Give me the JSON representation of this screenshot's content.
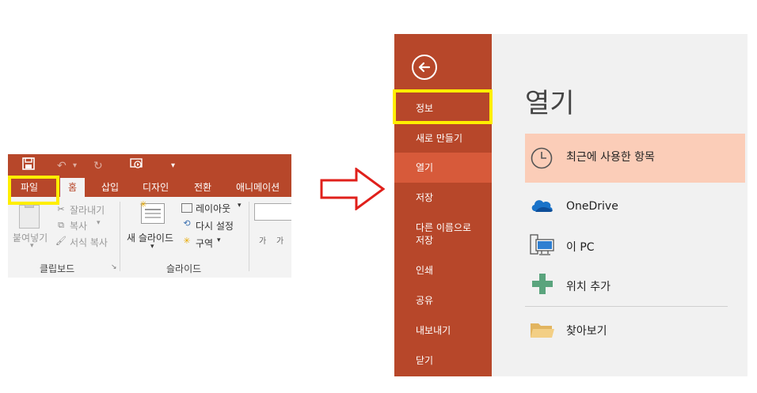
{
  "ribbon": {
    "qat_save_icon": "save-icon",
    "qat_undo": "↶",
    "qat_redo": "↻",
    "qat_customize": "▾",
    "tabs": [
      "파일",
      "홈",
      "삽입",
      "디자인",
      "전환",
      "애니메이션"
    ],
    "clipboard": {
      "paste": "붙여넣기",
      "cut": "잘라내기",
      "copy": "복사",
      "format_painter": "서식 복사",
      "group_label": "클립보드"
    },
    "slides": {
      "new_slide": "새 슬라이드",
      "layout": "레이아웃",
      "reset": "다시 설정",
      "section": "구역",
      "group_label": "슬라이드"
    },
    "font_group": {
      "grow": "가",
      "shrink": "가"
    }
  },
  "backstage": {
    "nav": [
      "정보",
      "새로 만들기",
      "열기",
      "저장",
      "다른 이름으로\n저장",
      "인쇄",
      "공유",
      "내보내기",
      "닫기"
    ],
    "title": "열기",
    "places": [
      "최근에 사용한 항목",
      "OneDrive",
      "이 PC",
      "위치 추가",
      "찾아보기"
    ]
  },
  "colors": {
    "accent": "#b7472a",
    "nav_active": "#d75a3a",
    "highlight": "#ffee00",
    "recent_bg": "#fbcdb8",
    "arrow": "#e0201b"
  }
}
